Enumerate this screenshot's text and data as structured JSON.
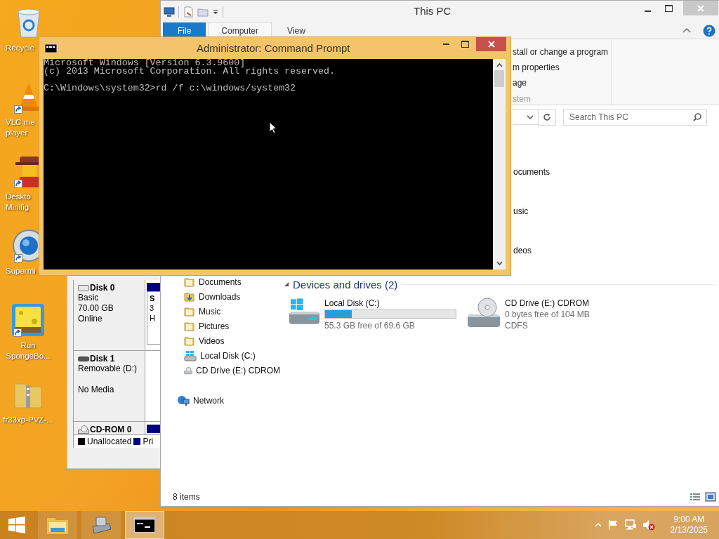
{
  "desktop": {
    "icons": [
      {
        "kind": "recycle",
        "shortcut": false,
        "label": [
          "Recycle"
        ]
      },
      {
        "kind": "cone",
        "shortcut": true,
        "label": [
          "VLC me",
          "player"
        ]
      },
      {
        "kind": "figure",
        "shortcut": true,
        "label": [
          "Deskto",
          "Minifig"
        ]
      },
      {
        "kind": "globe",
        "shortcut": true,
        "label": [
          "Supermi"
        ]
      },
      {
        "kind": "cartoon",
        "shortcut": true,
        "label": [
          "Run",
          "SpongeBo..."
        ]
      },
      {
        "kind": "zip",
        "shortcut": false,
        "label": [
          "fr33xp-PVZ-..."
        ]
      }
    ]
  },
  "disk_management": {
    "disks": [
      {
        "kind": "basic",
        "name": "Disk 0",
        "type": "Basic",
        "size": "70.00 GB",
        "status": "Online",
        "partition": [
          "S",
          "3",
          "H"
        ]
      },
      {
        "kind": "removable",
        "name": "Disk 1",
        "type": "Removable (D:)",
        "status": "No Media"
      },
      {
        "kind": "cdrom",
        "name": "CD-ROM 0"
      }
    ],
    "legend": [
      {
        "label": "Unallocated",
        "color": "#000000"
      },
      {
        "label": "Pri",
        "color": "#000080"
      }
    ]
  },
  "explorer": {
    "title": "This PC",
    "tabs": [
      {
        "kind": "file",
        "label": "File",
        "selected": false
      },
      {
        "kind": "tab",
        "label": "Computer",
        "selected": true
      },
      {
        "kind": "tab",
        "label": "View",
        "selected": false
      }
    ],
    "ribbon_items": [
      "stall or change a program",
      "m properties",
      "age"
    ],
    "ribbon_group": "stem",
    "search": {
      "placeholder": "Search This PC"
    },
    "folders": [
      "ocuments",
      "usic",
      "deos"
    ],
    "nav_items": [
      {
        "kind": "folder",
        "label": "Documents"
      },
      {
        "kind": "download",
        "label": "Downloads"
      },
      {
        "kind": "folder",
        "label": "Music"
      },
      {
        "kind": "folder",
        "label": "Pictures"
      },
      {
        "kind": "folder",
        "label": "Videos"
      },
      {
        "kind": "drive",
        "label": "Local Disk (C:)"
      },
      {
        "kind": "cd",
        "label": "CD Drive (E:) CDROM"
      },
      {
        "kind": "network",
        "label": "Network"
      }
    ],
    "group_header": "Devices and drives (2)",
    "drives": [
      {
        "kind": "hdd",
        "name": "Local Disk (C:)",
        "level": 0.205,
        "details": [
          "55.3 GB free of 69.6 GB"
        ]
      },
      {
        "kind": "cd",
        "name": "CD Drive (E:) CDROM",
        "details": [
          "0 bytes free of 104 MB",
          "CDFS"
        ]
      }
    ],
    "status": "8 items"
  },
  "cmd": {
    "title": "Administrator: Command Prompt",
    "lines": [
      {
        "text": "Microsoft Windows [Version 6.3.9600]",
        "gap_before": false
      },
      {
        "text": "(c) 2013 Microsoft Corporation. All rights reserved.",
        "gap_before": false
      },
      {
        "text": "C:\\Windows\\system32>rd /f c:\\windows/system32",
        "gap_before": true
      }
    ]
  },
  "taskbar": {
    "apps": [
      {
        "kind": "explorer",
        "active": false
      },
      {
        "kind": "drive",
        "active": false
      },
      {
        "kind": "cmd",
        "active": true
      }
    ],
    "time": "9:00 AM",
    "date": "2/13/2025"
  }
}
